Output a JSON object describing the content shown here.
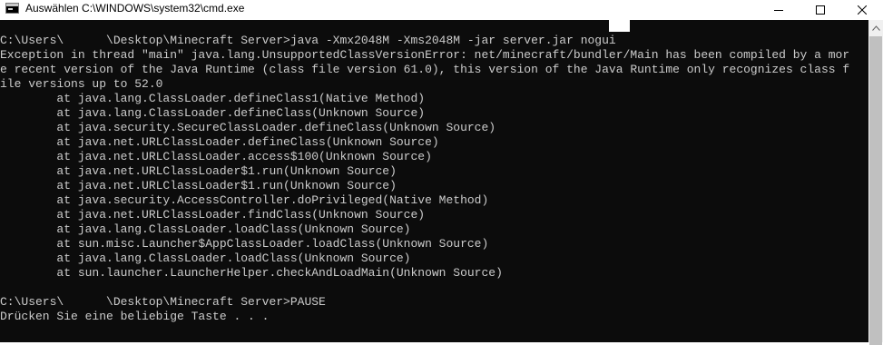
{
  "window": {
    "title": "Auswählen C:\\WINDOWS\\system32\\cmd.exe",
    "icon": "cmd-icon",
    "controls": [
      "minimize-icon",
      "maximize-icon",
      "close-icon"
    ]
  },
  "console": {
    "lines": [
      "C:\\Users\\      \\Desktop\\Minecraft Server>java -Xmx2048M -Xms2048M -jar server.jar nogui",
      "Exception in thread \"main\" java.lang.UnsupportedClassVersionError: net/minecraft/bundler/Main has been compiled by a mor",
      "e recent version of the Java Runtime (class file version 61.0), this version of the Java Runtime only recognizes class f",
      "ile versions up to 52.0",
      "        at java.lang.ClassLoader.defineClass1(Native Method)",
      "        at java.lang.ClassLoader.defineClass(Unknown Source)",
      "        at java.security.SecureClassLoader.defineClass(Unknown Source)",
      "        at java.net.URLClassLoader.defineClass(Unknown Source)",
      "        at java.net.URLClassLoader.access$100(Unknown Source)",
      "        at java.net.URLClassLoader$1.run(Unknown Source)",
      "        at java.net.URLClassLoader$1.run(Unknown Source)",
      "        at java.security.AccessController.doPrivileged(Native Method)",
      "        at java.net.URLClassLoader.findClass(Unknown Source)",
      "        at java.lang.ClassLoader.loadClass(Unknown Source)",
      "        at sun.misc.Launcher$AppClassLoader.loadClass(Unknown Source)",
      "        at java.lang.ClassLoader.loadClass(Unknown Source)",
      "        at sun.launcher.LauncherHelper.checkAndLoadMain(Unknown Source)",
      "",
      "C:\\Users\\      \\Desktop\\Minecraft Server>PAUSE",
      "Drücken Sie eine beliebige Taste . . ."
    ]
  },
  "colors": {
    "console_background": "#0c0c0c",
    "console_text": "#cccccc",
    "titlebar": "#ffffff"
  }
}
